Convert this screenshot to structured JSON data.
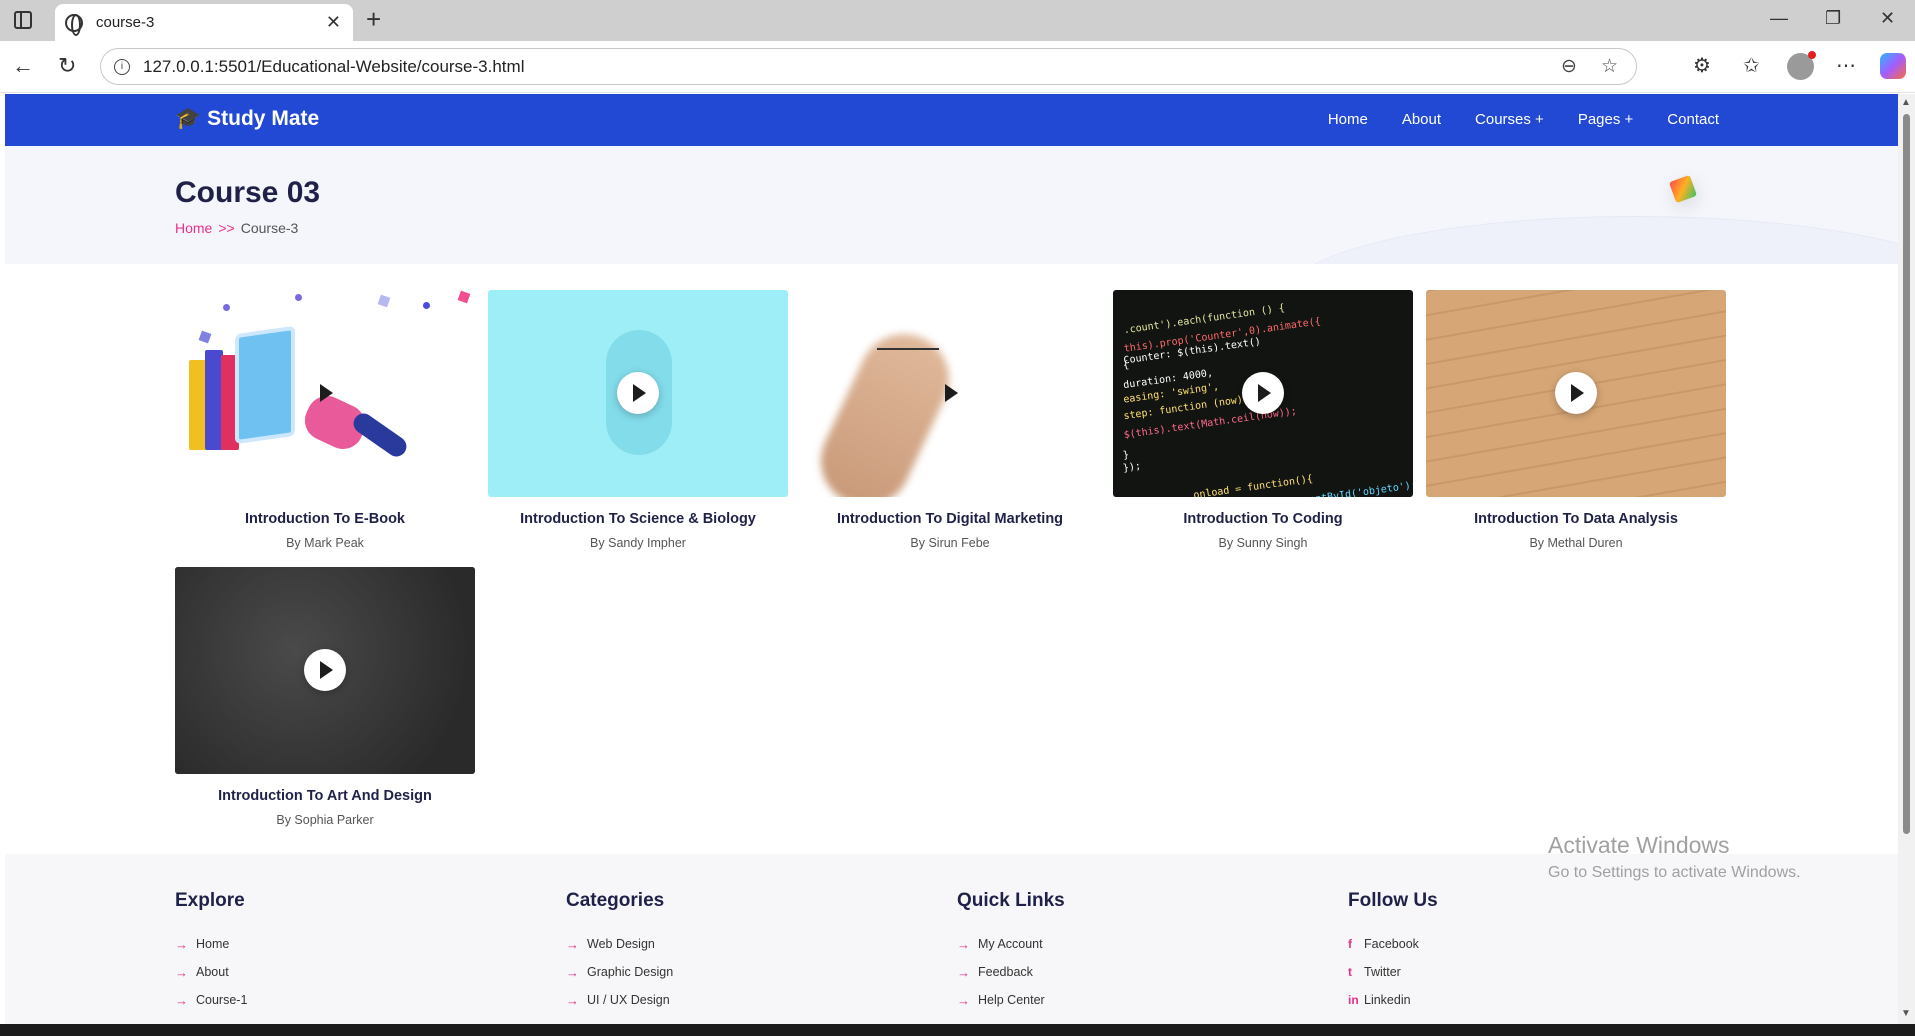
{
  "browser": {
    "tab_title": "course-3",
    "url": "127.0.0.1:5501/Educational-Website/course-3.html"
  },
  "site": {
    "brand": "Study Mate",
    "nav": [
      "Home",
      "About",
      "Courses +",
      "Pages +",
      "Contact"
    ]
  },
  "hero": {
    "title": "Course 03",
    "breadcrumb_home": "Home",
    "breadcrumb_sep": ">>",
    "breadcrumb_current": "Course-3"
  },
  "courses": [
    {
      "title": "Introduction To E-Book",
      "author": "By Mark Peak"
    },
    {
      "title": "Introduction To Science & Biology",
      "author": "By Sandy Impher"
    },
    {
      "title": "Introduction To Digital Marketing",
      "author": "By Sirun Febe"
    },
    {
      "title": "Introduction To Coding",
      "author": "By Sunny Singh"
    },
    {
      "title": "Introduction To Data Analysis",
      "author": "By Methal Duren"
    },
    {
      "title": "Introduction To Art And Design",
      "author": "By Sophia Parker"
    }
  ],
  "code_snippet": [
    ".count').each(function () {",
    "this).prop('Counter',0).animate({",
    "Counter: $(this).text()",
    "{",
    "duration: 4000,",
    "easing: 'swing',",
    "step: function (now) {",
    "$(this).text(Math.ceil(now));",
    "}",
    "});",
    "onload = function(){",
    "document.getElementById('objeto');"
  ],
  "footer": {
    "explore": {
      "heading": "Explore",
      "items": [
        "Home",
        "About",
        "Course-1"
      ]
    },
    "categories": {
      "heading": "Categories",
      "items": [
        "Web Design",
        "Graphic Design",
        "UI / UX Design"
      ]
    },
    "quick_links": {
      "heading": "Quick Links",
      "items": [
        "My Account",
        "Feedback",
        "Help Center"
      ]
    },
    "follow": {
      "heading": "Follow Us",
      "items": [
        "Facebook",
        "Twitter",
        "Linkedin"
      ],
      "icons": [
        "f",
        "t",
        "in"
      ]
    }
  },
  "watermark": {
    "line1": "Activate Windows",
    "line2": "Go to Settings to activate Windows."
  },
  "colors": {
    "brand_blue": "#2249d4",
    "accent_pink": "#e8308a"
  }
}
